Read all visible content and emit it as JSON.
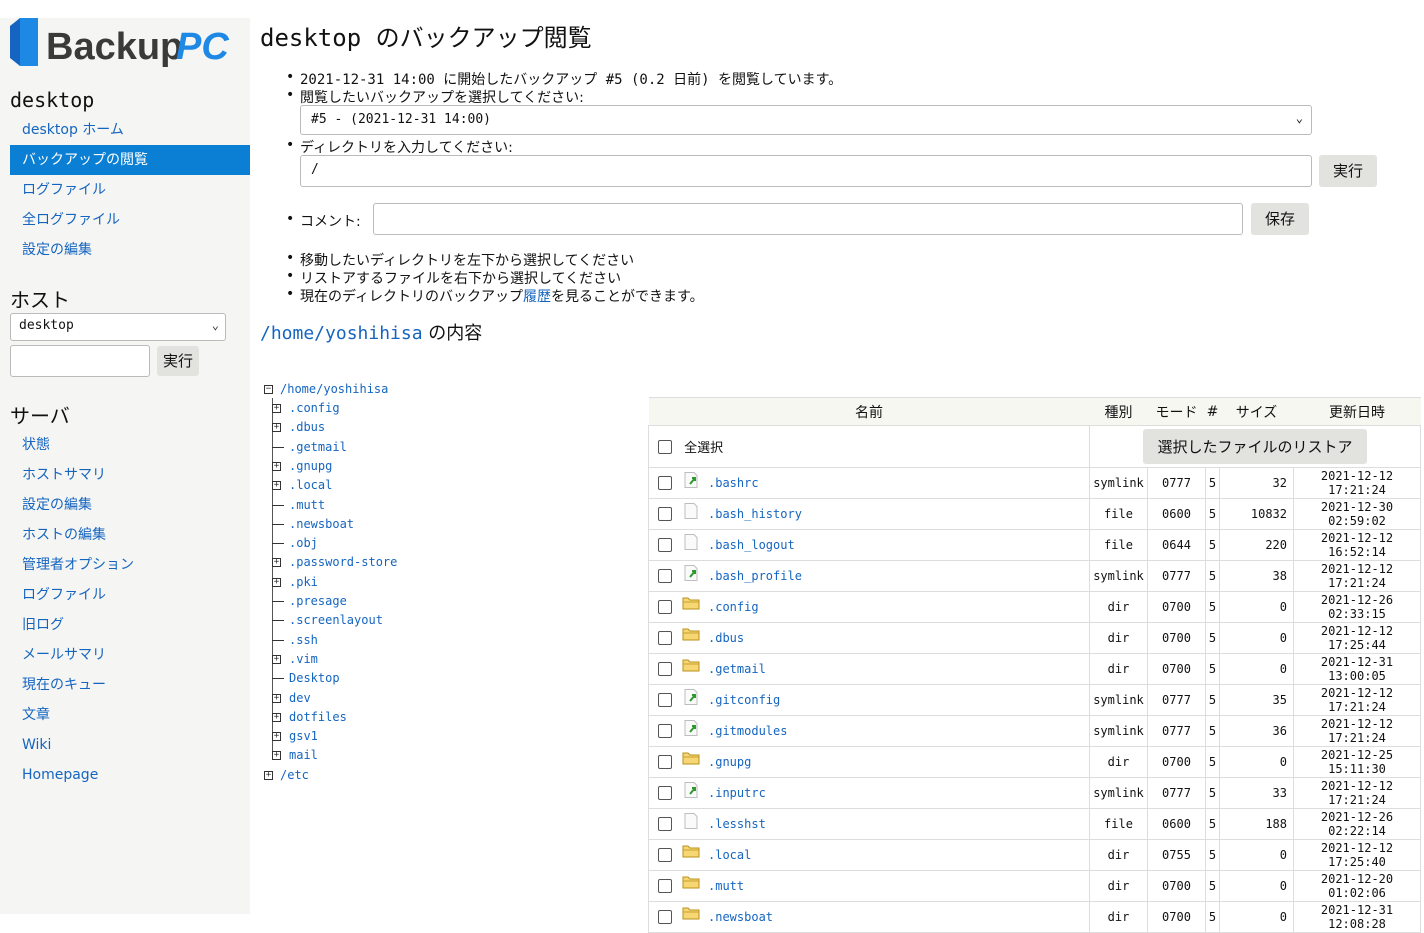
{
  "logo": {
    "text_a": "Backup",
    "text_b": "PC"
  },
  "sidebar": {
    "host_section_title": "desktop",
    "host_links": [
      {
        "label": "desktop ホーム"
      },
      {
        "label": "バックアップの閲覧",
        "active": true
      },
      {
        "label": "ログファイル"
      },
      {
        "label": "全ログファイル"
      },
      {
        "label": "設定の編集"
      }
    ],
    "hosts_title": "ホスト",
    "host_select_value": "desktop",
    "host_go": "実行",
    "server_title": "サーバ",
    "server_links": [
      {
        "label": "状態"
      },
      {
        "label": "ホストサマリ"
      },
      {
        "label": "設定の編集"
      },
      {
        "label": "ホストの編集"
      },
      {
        "label": "管理者オプション"
      },
      {
        "label": "ログファイル"
      },
      {
        "label": "旧ログ"
      },
      {
        "label": "メールサマリ"
      },
      {
        "label": "現在のキュー"
      },
      {
        "label": "文章"
      },
      {
        "label": "Wiki"
      },
      {
        "label": "Homepage"
      }
    ]
  },
  "main": {
    "title": "desktop のバックアップ閲覧",
    "info_line": "2021-12-31 14:00 に開始したバックアップ #5 (0.2 日前) を閲覧しています。",
    "select_prompt": "閲覧したいバックアップを選択してください:",
    "backup_select_value": "#5 - (2021-12-31 14:00)",
    "dir_prompt": "ディレクトリを入力してください:",
    "dir_value": "/",
    "dir_go": "実行",
    "comment_label": "コメント:",
    "comment_value": "",
    "save_label": "保存",
    "hint1": "移動したいディレクトリを左下から選択してください",
    "hint2": "リストアするファイルを右下から選択してください",
    "hint3_pre": "現在のディレクトリのバックアップ",
    "hint3_link": "履歴",
    "hint3_post": "を見ることができます。",
    "contents_path": "/home/yoshihisa",
    "contents_suffix": " の内容"
  },
  "tree": {
    "root": "/home/yoshihisa",
    "children": [
      {
        "name": ".config",
        "expandable": true
      },
      {
        "name": ".dbus",
        "expandable": true
      },
      {
        "name": ".getmail",
        "expandable": false
      },
      {
        "name": ".gnupg",
        "expandable": true
      },
      {
        "name": ".local",
        "expandable": true
      },
      {
        "name": ".mutt",
        "expandable": false
      },
      {
        "name": ".newsboat",
        "expandable": false
      },
      {
        "name": ".obj",
        "expandable": false
      },
      {
        "name": ".password-store",
        "expandable": true
      },
      {
        "name": ".pki",
        "expandable": true
      },
      {
        "name": ".presage",
        "expandable": false
      },
      {
        "name": ".screenlayout",
        "expandable": false
      },
      {
        "name": ".ssh",
        "expandable": false
      },
      {
        "name": ".vim",
        "expandable": true
      },
      {
        "name": "Desktop",
        "expandable": false
      },
      {
        "name": "dev",
        "expandable": true
      },
      {
        "name": "dotfiles",
        "expandable": true
      },
      {
        "name": "gsv1",
        "expandable": true
      },
      {
        "name": "mail",
        "expandable": true
      }
    ],
    "sibling": "/etc"
  },
  "table": {
    "headers": {
      "name": "名前",
      "type": "種別",
      "mode": "モード",
      "num": "#",
      "size": "サイズ",
      "mtime": "更新日時"
    },
    "select_all": "全選択",
    "restore_label": "選択したファイルのリストア",
    "rows": [
      {
        "name": ".bashrc",
        "type": "symlink",
        "mode": "0777",
        "num": "5",
        "size": "32",
        "mtime": "2021-12-12 17:21:24",
        "icon": "symlink-icon"
      },
      {
        "name": ".bash_history",
        "type": "file",
        "mode": "0600",
        "num": "5",
        "size": "10832",
        "mtime": "2021-12-30 02:59:02",
        "icon": "file-icon"
      },
      {
        "name": ".bash_logout",
        "type": "file",
        "mode": "0644",
        "num": "5",
        "size": "220",
        "mtime": "2021-12-12 16:52:14",
        "icon": "file-icon"
      },
      {
        "name": ".bash_profile",
        "type": "symlink",
        "mode": "0777",
        "num": "5",
        "size": "38",
        "mtime": "2021-12-12 17:21:24",
        "icon": "symlink-icon"
      },
      {
        "name": ".config",
        "type": "dir",
        "mode": "0700",
        "num": "5",
        "size": "0",
        "mtime": "2021-12-26 02:33:15",
        "icon": "folder-icon"
      },
      {
        "name": ".dbus",
        "type": "dir",
        "mode": "0700",
        "num": "5",
        "size": "0",
        "mtime": "2021-12-12 17:25:44",
        "icon": "folder-icon"
      },
      {
        "name": ".getmail",
        "type": "dir",
        "mode": "0700",
        "num": "5",
        "size": "0",
        "mtime": "2021-12-31 13:00:05",
        "icon": "folder-icon"
      },
      {
        "name": ".gitconfig",
        "type": "symlink",
        "mode": "0777",
        "num": "5",
        "size": "35",
        "mtime": "2021-12-12 17:21:24",
        "icon": "symlink-icon"
      },
      {
        "name": ".gitmodules",
        "type": "symlink",
        "mode": "0777",
        "num": "5",
        "size": "36",
        "mtime": "2021-12-12 17:21:24",
        "icon": "symlink-icon"
      },
      {
        "name": ".gnupg",
        "type": "dir",
        "mode": "0700",
        "num": "5",
        "size": "0",
        "mtime": "2021-12-25 15:11:30",
        "icon": "folder-icon"
      },
      {
        "name": ".inputrc",
        "type": "symlink",
        "mode": "0777",
        "num": "5",
        "size": "33",
        "mtime": "2021-12-12 17:21:24",
        "icon": "symlink-icon"
      },
      {
        "name": ".lesshst",
        "type": "file",
        "mode": "0600",
        "num": "5",
        "size": "188",
        "mtime": "2021-12-26 02:22:14",
        "icon": "file-icon"
      },
      {
        "name": ".local",
        "type": "dir",
        "mode": "0755",
        "num": "5",
        "size": "0",
        "mtime": "2021-12-12 17:25:40",
        "icon": "folder-icon"
      },
      {
        "name": ".mutt",
        "type": "dir",
        "mode": "0700",
        "num": "5",
        "size": "0",
        "mtime": "2021-12-20 01:02:06",
        "icon": "folder-icon"
      },
      {
        "name": ".newsboat",
        "type": "dir",
        "mode": "0700",
        "num": "5",
        "size": "0",
        "mtime": "2021-12-31 12:08:28",
        "icon": "folder-icon"
      }
    ]
  },
  "colors": {
    "accent": "#0a7fd3",
    "link": "#1565c0",
    "sidebar_bg": "#f5f5f3"
  }
}
